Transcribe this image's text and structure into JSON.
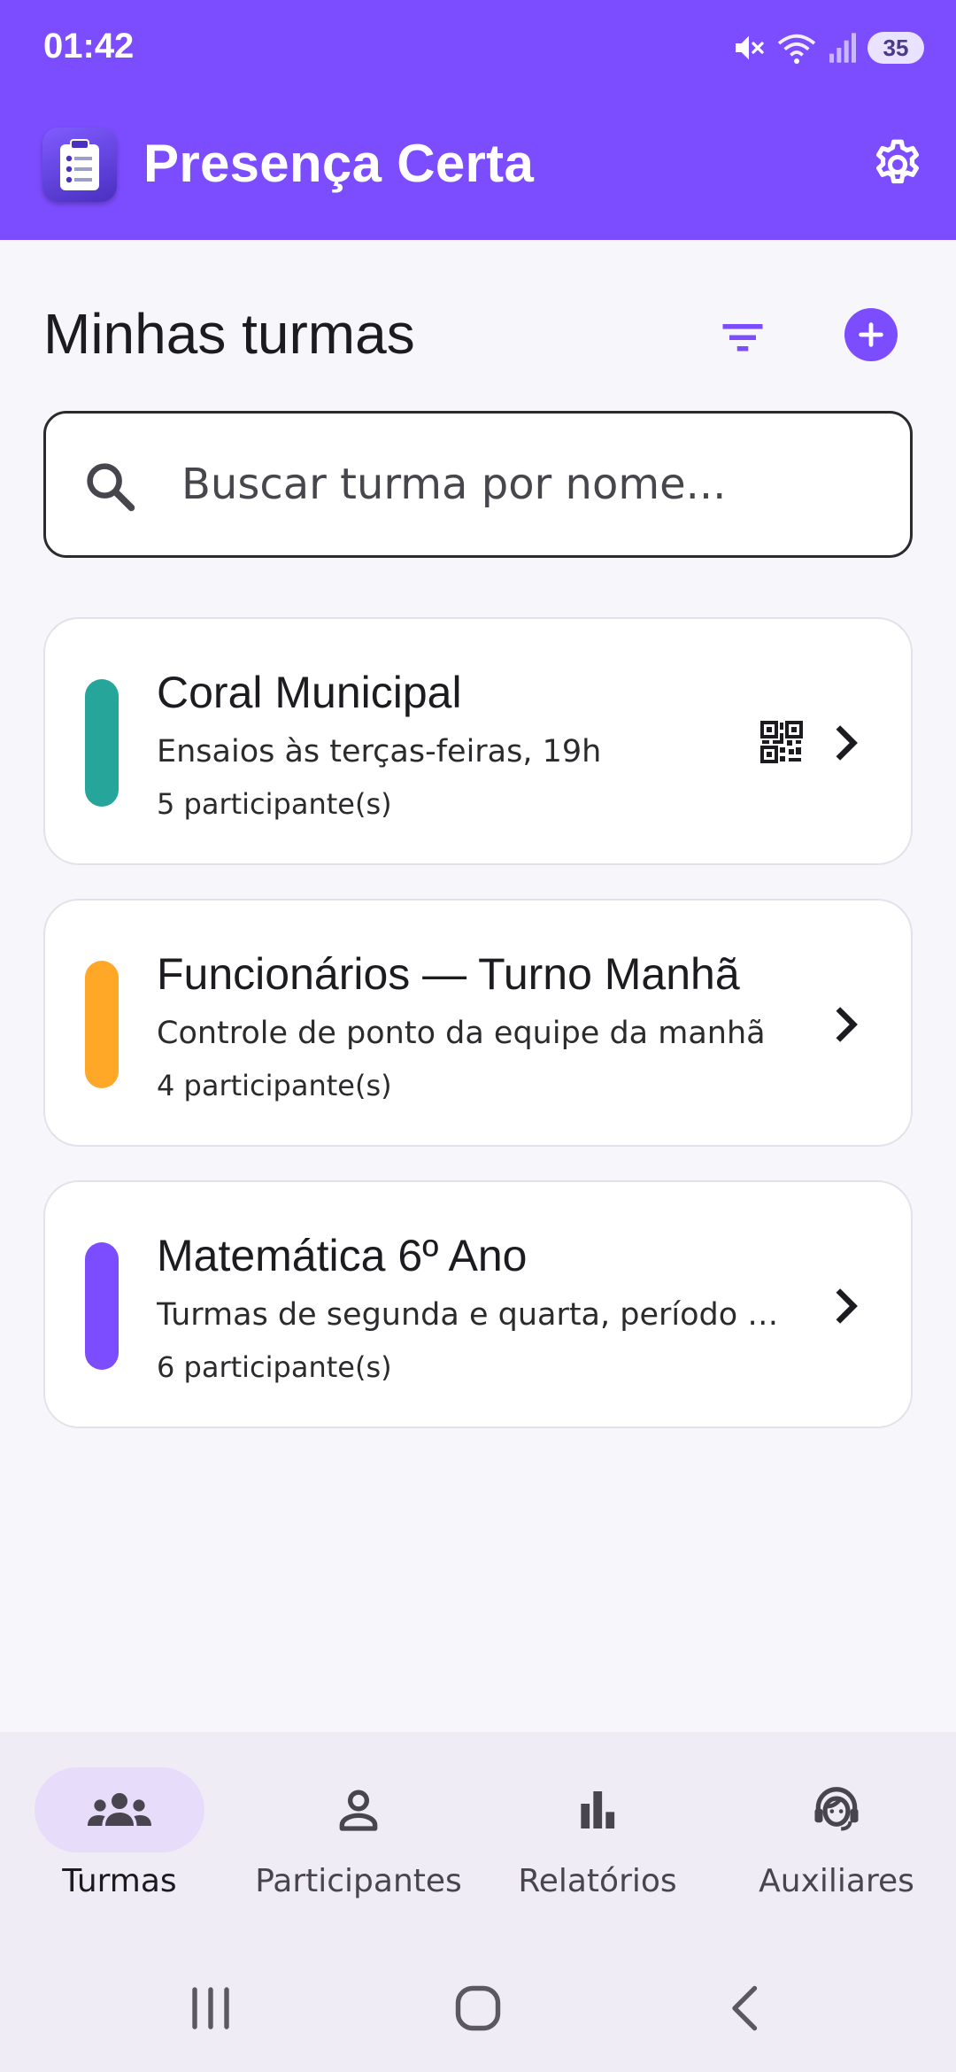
{
  "status_bar": {
    "time": "01:42",
    "battery": "35",
    "icons": [
      "mute-icon",
      "wifi-icon",
      "signal-icon"
    ]
  },
  "app_bar": {
    "title": "Presença Certa",
    "background_color": "#7c4dff",
    "icons": [
      "app-logo-icon",
      "gear-icon"
    ]
  },
  "section": {
    "title": "Minhas turmas",
    "actions": [
      "filter-icon",
      "add-icon"
    ]
  },
  "search": {
    "placeholder": "Buscar turma por nome...",
    "value": ""
  },
  "classes": [
    {
      "title": "Coral Municipal",
      "description": "Ensaios às terças-feiras, 19h",
      "participants": "5 participante(s)",
      "color": "#26a69a",
      "has_qr": true
    },
    {
      "title": "Funcionários — Turno Manhã",
      "description": "Controle de ponto da equipe da manhã",
      "participants": "4 participante(s)",
      "color": "#ffa726",
      "has_qr": false
    },
    {
      "title": "Matemática 6º Ano",
      "description": "Turmas de segunda e quarta, período …",
      "participants": "6 participante(s)",
      "color": "#7c4dff",
      "has_qr": false
    }
  ],
  "bottom_nav": {
    "items": [
      {
        "label": "Turmas",
        "icon": "groups-icon",
        "active": true
      },
      {
        "label": "Participantes",
        "icon": "person-icon",
        "active": false
      },
      {
        "label": "Relatórios",
        "icon": "bar-chart-icon",
        "active": false
      },
      {
        "label": "Auxiliares",
        "icon": "support-agent-icon",
        "active": false
      }
    ]
  },
  "system_nav": [
    "recents-button",
    "home-button",
    "back-button"
  ]
}
